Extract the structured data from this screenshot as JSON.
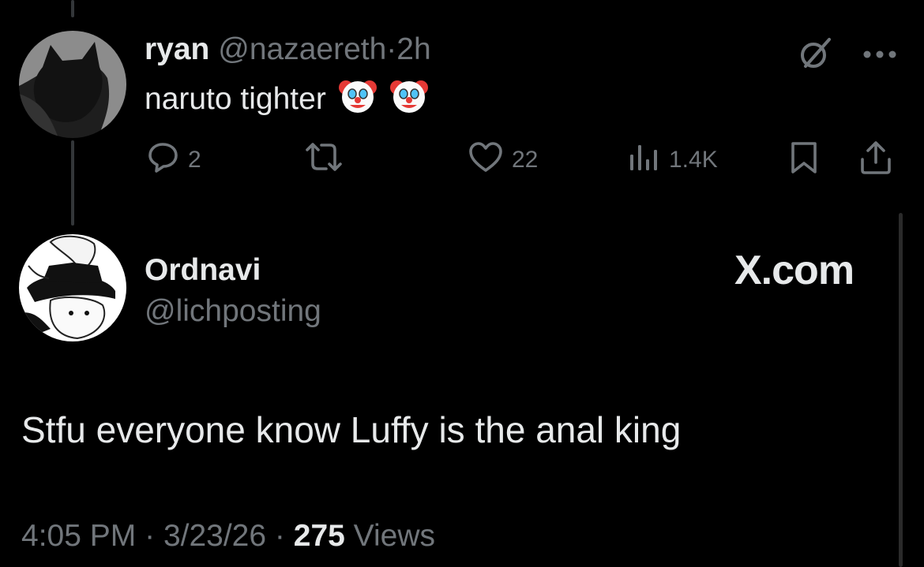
{
  "reply": {
    "name": "ryan",
    "handle": "@nazaereth",
    "separator": "·",
    "time": "2h",
    "text": "naruto tighter",
    "emoji": [
      "clown-face",
      "clown-face"
    ],
    "actions": {
      "replies": "2",
      "reposts": "",
      "likes": "22",
      "views": "1.4K"
    }
  },
  "main_tweet": {
    "name": "Ordnavi",
    "handle": "@lichposting",
    "site_label": "X.com",
    "text": "Stfu everyone know Luffy is the anal king",
    "time": "4:05 PM",
    "date": "3/23/26",
    "sep1": "·",
    "sep2": "·",
    "views_count": "275",
    "views_label": "Views"
  },
  "colors": {
    "background": "#000000",
    "text": "#e7e9ea",
    "muted": "#71767b"
  }
}
